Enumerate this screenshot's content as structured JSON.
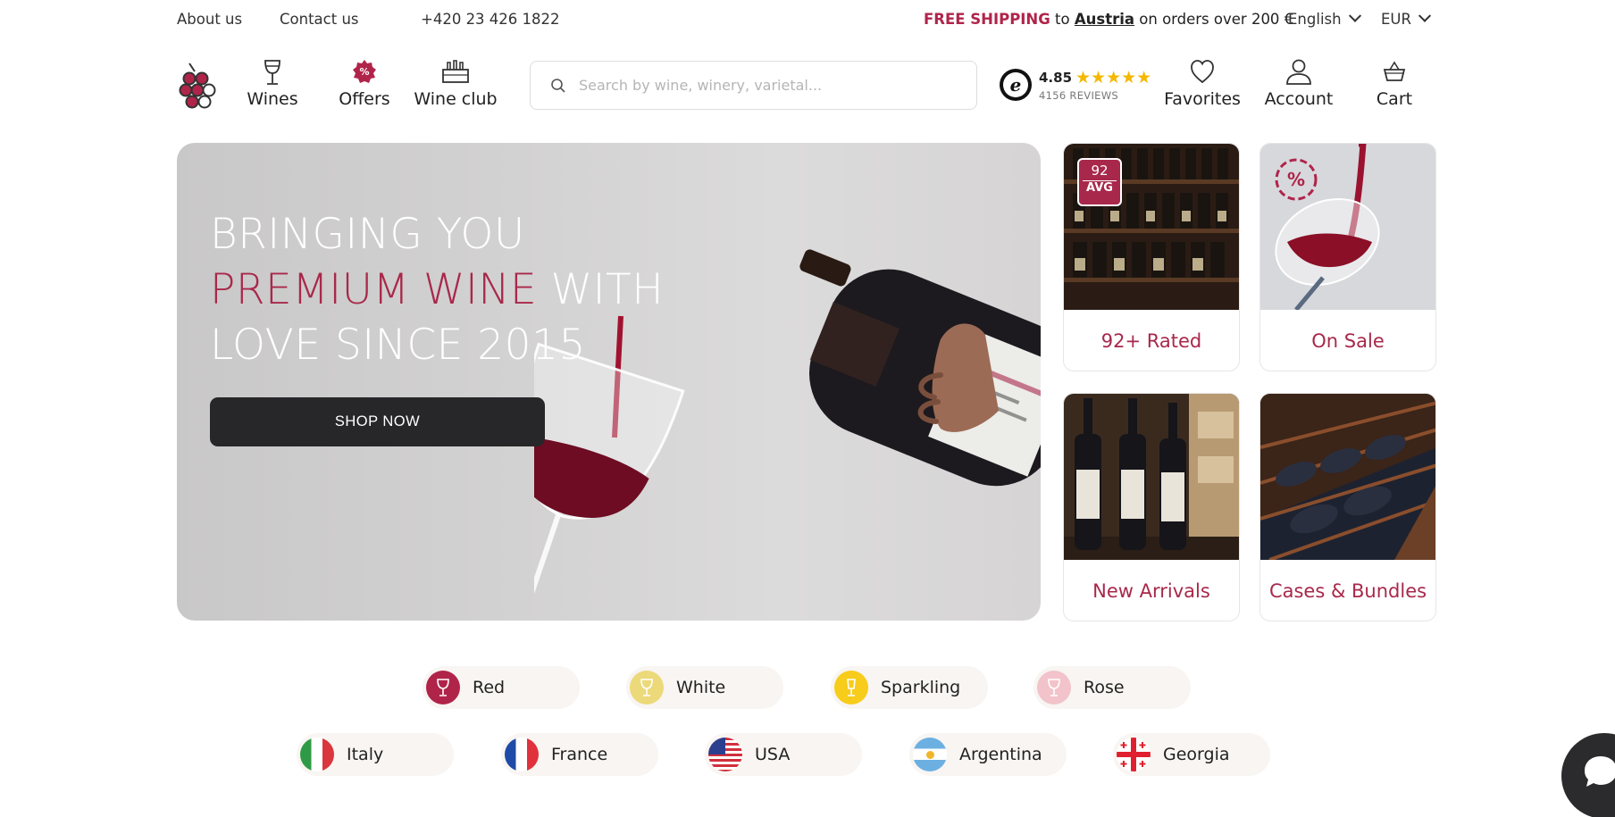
{
  "topbar": {
    "about": "About us",
    "contact": "Contact us",
    "phone": "+420 23 426 1822",
    "shipping_highlight": "FREE SHIPPING",
    "shipping_to": "to",
    "shipping_country": "Austria",
    "shipping_rest": "on orders over 200 €",
    "language": "English",
    "currency": "EUR"
  },
  "nav": {
    "wines": "Wines",
    "offers": "Offers",
    "wineclub": "Wine club",
    "favorites": "Favorites",
    "account": "Account",
    "cart": "Cart"
  },
  "search": {
    "placeholder": "Search by wine, winery, varietal..."
  },
  "rating": {
    "score": "4.85",
    "stars": "★★★★★",
    "reviews": "4156 REVIEWS"
  },
  "hero": {
    "line1": "BRINGING YOU",
    "line2_accent": "PREMIUM WINE",
    "line2_rest": "WITH",
    "line3": "LOVE SINCE 2015",
    "cta": "SHOP NOW"
  },
  "tiles": [
    {
      "label": "92+ Rated",
      "badge_num": "92",
      "badge_txt": "AVG"
    },
    {
      "label": "On Sale",
      "badge": "%"
    },
    {
      "label": "New Arrivals"
    },
    {
      "label": "Cases & Bundles"
    }
  ],
  "wine_types": [
    {
      "label": "Red",
      "color": "#b0244a"
    },
    {
      "label": "White",
      "color": "#ecd97a"
    },
    {
      "label": "Sparkling",
      "color": "#f7cc1a"
    },
    {
      "label": "Rose",
      "color": "#f2c3cb"
    }
  ],
  "countries": [
    {
      "label": "Italy"
    },
    {
      "label": "France"
    },
    {
      "label": "USA"
    },
    {
      "label": "Argentina"
    },
    {
      "label": "Georgia"
    }
  ],
  "colors": {
    "accent": "#a8284b",
    "dark": "#272729",
    "star": "#f5b800"
  }
}
